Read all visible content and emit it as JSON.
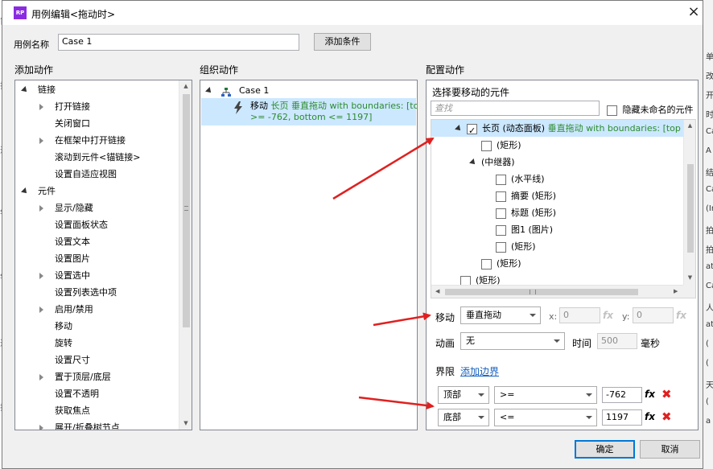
{
  "window": {
    "title": "用例编辑<拖动时>",
    "close_glyph": "×",
    "logo_text": "RP"
  },
  "case_name": {
    "label": "用例名称",
    "value": "Case 1",
    "add_condition": "添加条件"
  },
  "add_actions": {
    "header": "添加动作",
    "items": [
      {
        "text": "链接",
        "level": 0,
        "expander": "open"
      },
      {
        "text": "打开链接",
        "level": 1,
        "expander": "closed"
      },
      {
        "text": "关闭窗口",
        "level": 1,
        "expander": "none"
      },
      {
        "text": "在框架中打开链接",
        "level": 1,
        "expander": "closed"
      },
      {
        "text": "滚动到元件<锚链接>",
        "level": 1,
        "expander": "none"
      },
      {
        "text": "设置自适应视图",
        "level": 1,
        "expander": "none"
      },
      {
        "text": "元件",
        "level": 0,
        "expander": "open"
      },
      {
        "text": "显示/隐藏",
        "level": 1,
        "expander": "closed"
      },
      {
        "text": "设置面板状态",
        "level": 1,
        "expander": "none"
      },
      {
        "text": "设置文本",
        "level": 1,
        "expander": "none"
      },
      {
        "text": "设置图片",
        "level": 1,
        "expander": "none"
      },
      {
        "text": "设置选中",
        "level": 1,
        "expander": "closed"
      },
      {
        "text": "设置列表选中项",
        "level": 1,
        "expander": "none"
      },
      {
        "text": "启用/禁用",
        "level": 1,
        "expander": "closed"
      },
      {
        "text": "移动",
        "level": 1,
        "expander": "none"
      },
      {
        "text": "旋转",
        "level": 1,
        "expander": "none"
      },
      {
        "text": "设置尺寸",
        "level": 1,
        "expander": "none"
      },
      {
        "text": "置于顶层/底层",
        "level": 1,
        "expander": "closed"
      },
      {
        "text": "设置不透明",
        "level": 1,
        "expander": "none"
      },
      {
        "text": "获取焦点",
        "level": 1,
        "expander": "none"
      },
      {
        "text": "展开/折叠树节点",
        "level": 1,
        "expander": "closed"
      }
    ]
  },
  "organize_actions": {
    "header": "组织动作",
    "case_label": "Case 1",
    "action_line1_prefix": "移动 ",
    "action_line1_green": "长页 垂直拖动 with boundaries: [top",
    "action_line2_green": ">= -762, bottom <= 1197]"
  },
  "config": {
    "header": "配置动作",
    "select_label": "选择要移动的元件",
    "search_placeholder": "查找",
    "hide_unnamed": "隐藏未命名的元件",
    "tree": [
      {
        "label": "长页 (动态面板) ",
        "green": "垂直拖动 with boundaries: [top >= -",
        "indent": 0,
        "expander": "open",
        "checkbox": true,
        "checked": true,
        "selected": true
      },
      {
        "label": "(矩形)",
        "indent": 1,
        "expander": "none",
        "checkbox": true,
        "checked": false
      },
      {
        "label": "(中继器)",
        "indent": 1,
        "expander": "open",
        "checkbox": false
      },
      {
        "label": "(水平线)",
        "indent": 2,
        "expander": "none",
        "checkbox": true,
        "checked": false
      },
      {
        "label": "摘要 (矩形)",
        "indent": 2,
        "expander": "none",
        "checkbox": true,
        "checked": false
      },
      {
        "label": "标题 (矩形)",
        "indent": 2,
        "expander": "none",
        "checkbox": true,
        "checked": false
      },
      {
        "label": "图1 (图片)",
        "indent": 2,
        "expander": "none",
        "checkbox": true,
        "checked": false
      },
      {
        "label": "(矩形)",
        "indent": 2,
        "expander": "none",
        "checkbox": true,
        "checked": false
      },
      {
        "label": "(矩形)",
        "indent": 1,
        "expander": "none",
        "checkbox": true,
        "checked": false
      },
      {
        "label": "(矩形)",
        "indent": -1,
        "expander": "none",
        "checkbox": true,
        "checked": false
      }
    ],
    "move_label": "移动",
    "move_value": "垂直拖动",
    "x_label": "x:",
    "x_value": "0",
    "y_label": "y:",
    "y_value": "0",
    "fx": "fx",
    "anim_label": "动画",
    "anim_value": "无",
    "time_label": "时间",
    "time_value": "500",
    "ms_label": "毫秒",
    "bounds_label": "界限",
    "add_bound_link": "添加边界",
    "bounds": [
      {
        "side": "顶部",
        "op": ">=",
        "value": "-762"
      },
      {
        "side": "底部",
        "op": "<=",
        "value": "1197"
      }
    ],
    "delete_glyph": "✖"
  },
  "footer": {
    "ok": "确定",
    "cancel": "取消"
  },
  "background_chars": [
    "单",
    "改",
    "开",
    "时",
    "Ca",
    "A",
    "结",
    "Ca",
    "(In",
    "拍",
    "拍",
    "ato",
    "Ca",
    "人",
    "at",
    "(",
    "(",
    "天",
    "(",
    "a"
  ],
  "left_edge_chars": [
    "宙",
    "拉",
    "透",
    "ss",
    "ss",
    "透",
    "拉"
  ],
  "colors": {
    "accent_blue": "#0078d7",
    "selection": "#cce8ff",
    "action_green": "#2e8b2e",
    "delete_red": "#e02020",
    "arrow_red": "#e02020"
  }
}
